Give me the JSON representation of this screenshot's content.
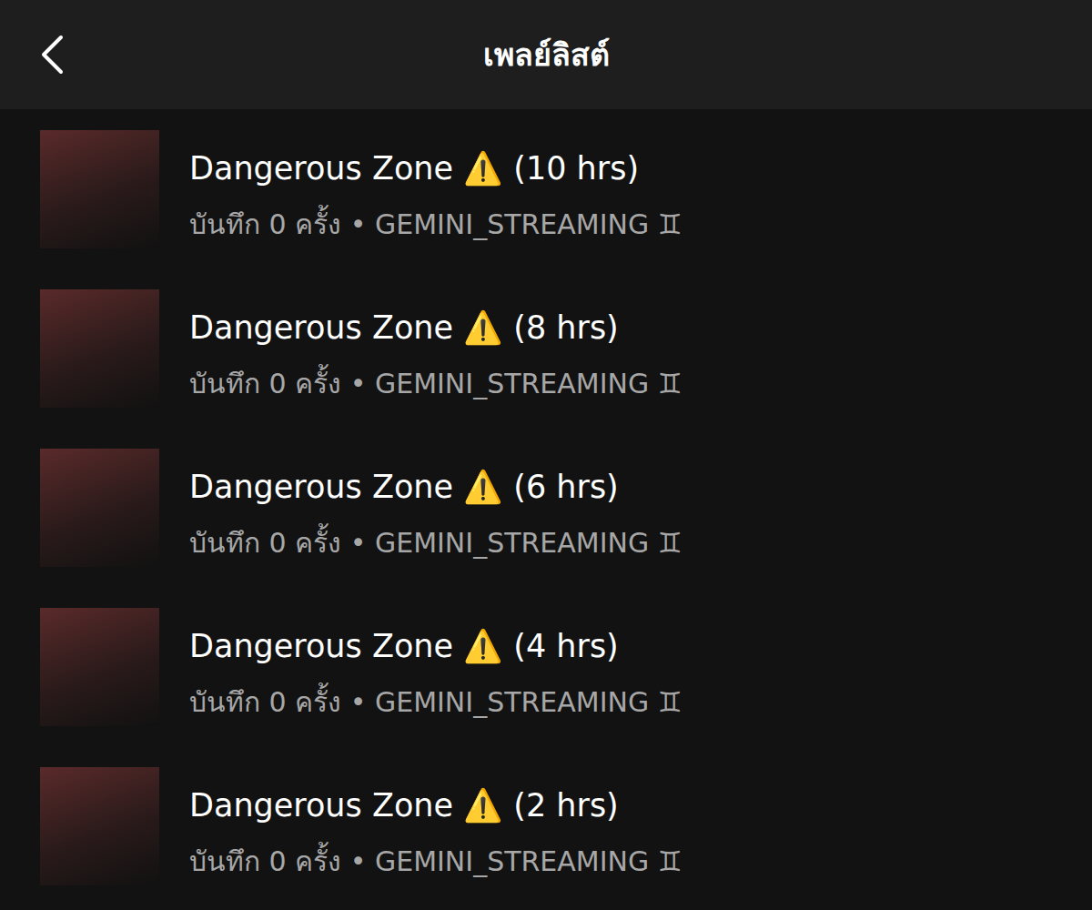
{
  "header": {
    "title": "เพลย์ลิสต์"
  },
  "playlists": [
    {
      "title": "Dangerous Zone ⚠️ (10 hrs)",
      "subtitle": "บันทึก 0 ครั้ง • GEMINI_STREAMING ♊"
    },
    {
      "title": "Dangerous Zone ⚠️ (8 hrs)",
      "subtitle": "บันทึก 0 ครั้ง • GEMINI_STREAMING ♊"
    },
    {
      "title": "Dangerous Zone ⚠️ (6 hrs)",
      "subtitle": "บันทึก 0 ครั้ง • GEMINI_STREAMING ♊"
    },
    {
      "title": "Dangerous Zone ⚠️ (4 hrs)",
      "subtitle": "บันทึก 0 ครั้ง • GEMINI_STREAMING ♊"
    },
    {
      "title": "Dangerous Zone ⚠️ (2 hrs)",
      "subtitle": "บันทึก 0 ครั้ง • GEMINI_STREAMING ♊"
    }
  ]
}
